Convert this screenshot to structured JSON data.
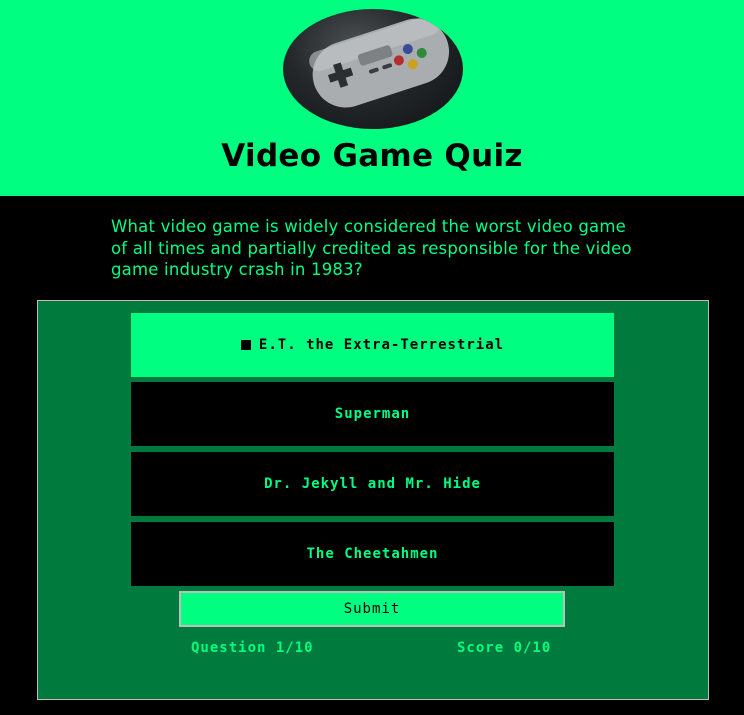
{
  "header": {
    "title": "Video Game Quiz",
    "logo_icon": "gamepad-controller-image"
  },
  "quiz": {
    "question": "What video game is widely considered the worst video game of all times and partially credited as responsible for the video game industry crash in 1983?",
    "answers": [
      {
        "label": "E.T. the Extra-Terrestrial",
        "selected": true
      },
      {
        "label": "Superman",
        "selected": false
      },
      {
        "label": "Dr. Jekyll and Mr. Hide",
        "selected": false
      },
      {
        "label": "The Cheetahmen",
        "selected": false
      }
    ],
    "submit_label": "Submit",
    "progress_text": "Question 1/10",
    "score_text": "Score 0/10"
  },
  "colors": {
    "accent": "#00ff80",
    "panel": "#007a3d",
    "background": "#000000"
  }
}
